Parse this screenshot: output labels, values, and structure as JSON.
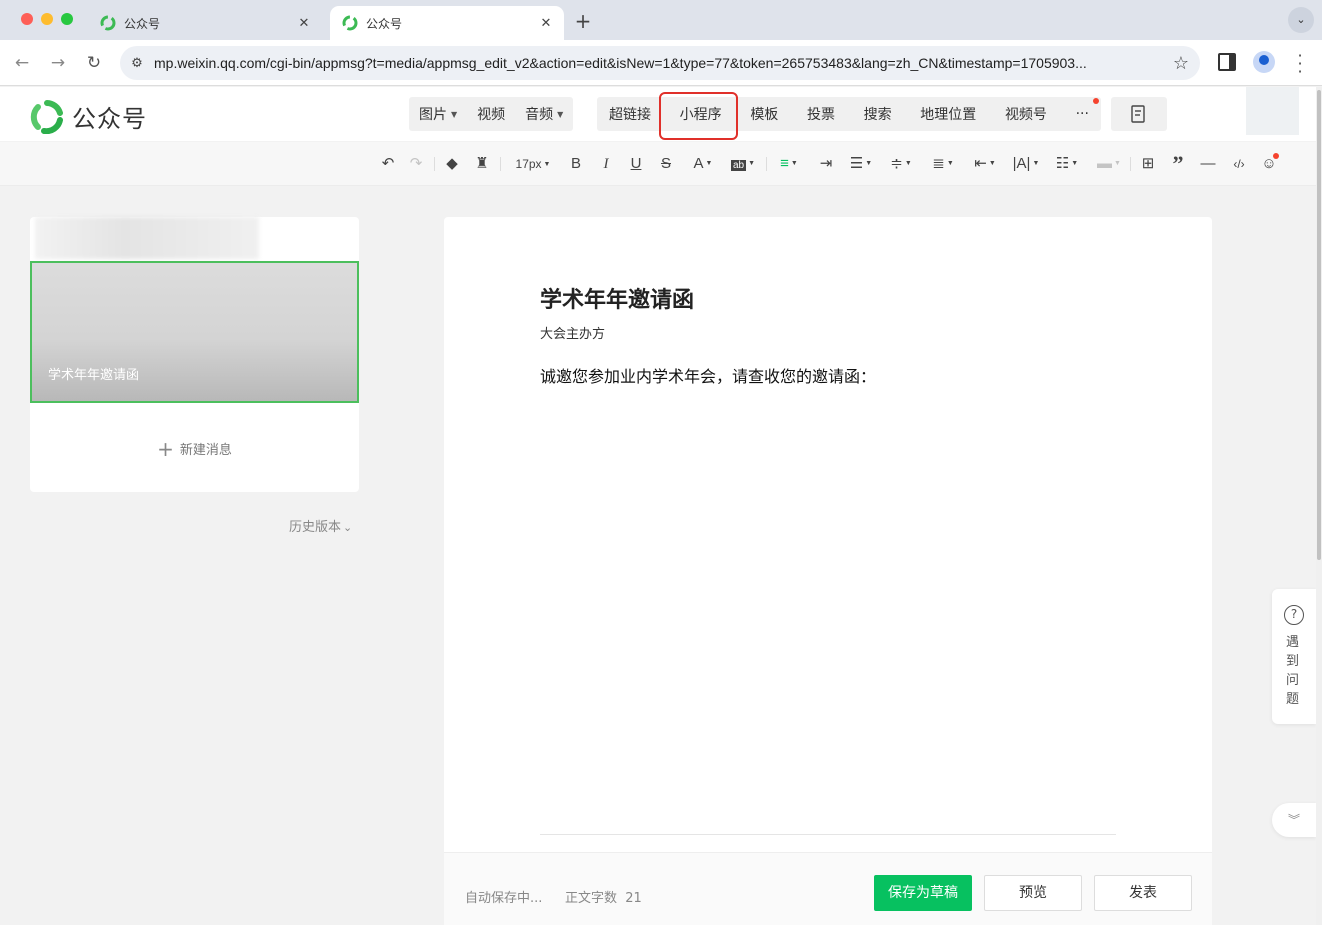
{
  "browser": {
    "tabs": [
      {
        "title": "公众号",
        "active": false
      },
      {
        "title": "公众号",
        "active": true
      }
    ],
    "new_tab": "+",
    "tab_menu": "⌄",
    "url": "mp.weixin.qq.com/cgi-bin/appmsg?t=media/appmsg_edit_v2&action=edit&isNew=1&type=77&token=265753483&lang=zh_CN&timestamp=1705903..."
  },
  "app": {
    "brand": "公众号",
    "insert_menu_1": [
      {
        "label": "图片",
        "has_caret": true
      },
      {
        "label": "视频",
        "has_caret": false
      },
      {
        "label": "音频",
        "has_caret": true
      }
    ],
    "insert_menu_2": [
      {
        "label": "超链接"
      },
      {
        "label": "小程序",
        "highlighted": true
      },
      {
        "label": "模板"
      },
      {
        "label": "投票"
      },
      {
        "label": "搜索"
      },
      {
        "label": "地理位置"
      },
      {
        "label": "视频号"
      },
      {
        "label": "···"
      }
    ],
    "highlight_color": "#e0302a",
    "accent_color": "#07c160"
  },
  "format_toolbar": {
    "font_size": "17px"
  },
  "left_panel": {
    "article_caption": "学术年年邀请函",
    "new_message": "新建消息",
    "history": "历史版本"
  },
  "editor": {
    "title": "学术年年邀请函",
    "author": "大会主办方",
    "body": "诚邀您参加业内学术年会，请查收您的邀请函："
  },
  "footer": {
    "autosave": "自动保存中...",
    "word_count_label": "正文字数",
    "word_count": "21",
    "save_draft": "保存为草稿",
    "preview": "预览",
    "publish": "发表"
  },
  "help": {
    "text": "遇到问题"
  }
}
